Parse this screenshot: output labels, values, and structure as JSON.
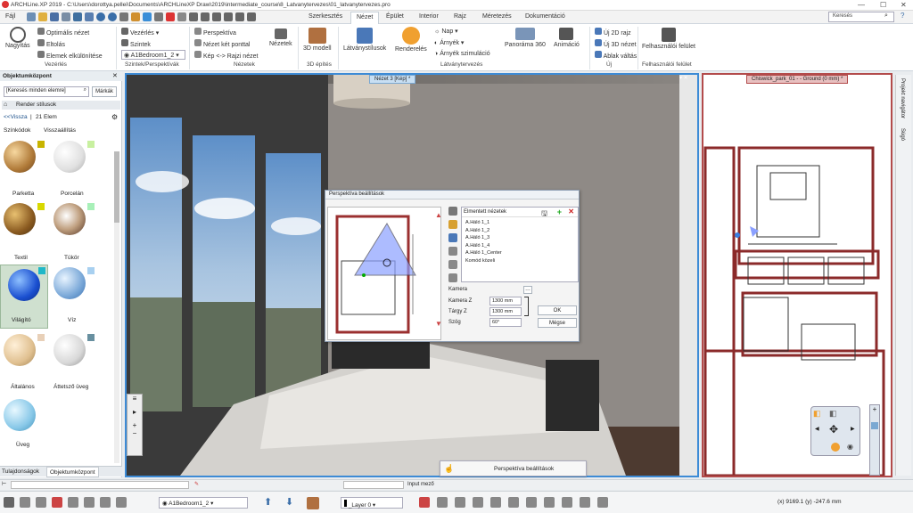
{
  "window": {
    "title": "ARCHLine.XP 2019 - C:\\Users\\dorottya.pellei\\Documents\\ARCHLineXP Draw\\2019\\intermediate_course\\8_Latvanytervezes\\01_latvanytervezes.pro"
  },
  "tabs": [
    "Fájl",
    "Szerkesztés",
    "Nézet",
    "Épület",
    "Interior",
    "Rajz",
    "Méretezés",
    "Dokumentáció"
  ],
  "active_tab": "Nézet",
  "search": {
    "placeholder": "Keresés"
  },
  "ribbon": {
    "nagyitas": "Nagyítás",
    "optimalis": "Optimális nézet",
    "eltolas": "Eltolás",
    "elemek": "Elemek elkülönítése",
    "vezerles": "Vezérlés",
    "szintek": "Szintek",
    "szint_value": "A1Bedroom1_2",
    "perspektiva": "Perspektíva",
    "nezet_ket": "Nézet két ponttal",
    "kep_rajzi": "Kép <-> Rajzi nézet",
    "nezetek": "Nézetek",
    "modell3d": "3D modell",
    "latvanystilusok": "Látványstílusok",
    "rendereles": "Renderelés",
    "nap": "Nap",
    "arnyek": "Árnyék",
    "arnyek_szim": "Árnyék szimuláció",
    "panorama": "Panoráma 360",
    "animacio": "Animáció",
    "uj2d": "Új 2D rajz",
    "uj3d": "Új 3D nézet",
    "ablak": "Ablak váltás",
    "felhasznaloi": "Felhasználói felület"
  },
  "groups": {
    "vezerles": "Vezérlés",
    "szintek": "Szintek/Perspektívák",
    "nezetek": "Nézetek",
    "epites": "3D építés",
    "latvany": "Látványtervezés",
    "uj": "Új",
    "felulet": "Felhasználói felület"
  },
  "left_panel": {
    "title": "Objektumközpont",
    "search_placeholder": "[Keresés minden elemre]",
    "markak": "Márkák",
    "render_stilusok": "Render stílusok",
    "vissza": "<<Vissza",
    "count": "21 Elem",
    "szinkodok": "Színkódok",
    "visszaallitas": "Visszaállítás",
    "materials": [
      {
        "name": "Parketta",
        "swatch": "#c8b400"
      },
      {
        "name": "Porcelán",
        "swatch": "#c8f0a0"
      },
      {
        "name": "Textil",
        "swatch": "#d8d800"
      },
      {
        "name": "Tükör",
        "swatch": "#a8f0b8"
      },
      {
        "name": "Világító",
        "swatch": "#20b8c8"
      },
      {
        "name": "Víz",
        "swatch": "#a8d0f0"
      },
      {
        "name": "Általános",
        "swatch": "#e8d0b8"
      },
      {
        "name": "Áttetsző üveg",
        "swatch": "#6890a0"
      },
      {
        "name": "Üveg",
        "swatch": ""
      }
    ],
    "tab_tulajdonsagok": "Tulajdonságok",
    "tab_objektumkozpont": "Objektumközpont"
  },
  "viewport": {
    "title": "Nézet 3 [Kép] *"
  },
  "planview": {
    "title": "Chiswick_park_01 - - Ground (0 mm) *"
  },
  "right_tabs": [
    "Projekt navigátor",
    "Súgó"
  ],
  "dialog": {
    "title": "Perspektíva beállítások",
    "saved_views_label": "Elmentett nézetek",
    "views": [
      "A.Háló 1_1",
      "A.Háló 1_2",
      "A.Háló 1_3",
      "A.Háló 1_4",
      "A.Háló 1_Center",
      "Komód közeli"
    ],
    "kamera": "Kamera",
    "kamera_z": "Kamera Z",
    "kamera_z_val": "1300 mm",
    "targy_z": "Tárgy Z",
    "targy_z_val": "1300 mm",
    "szog": "Szög",
    "szog_val": "60°",
    "ok": "OK",
    "megse": "Mégse"
  },
  "tooltip_bar": "Perspektíva beállítások",
  "status": {
    "level": "A1Bedroom1_2",
    "layer": "_Layer 0",
    "input_label": "Input mező",
    "coords": "(x) 9169.1   (y) -247.6 mm"
  }
}
